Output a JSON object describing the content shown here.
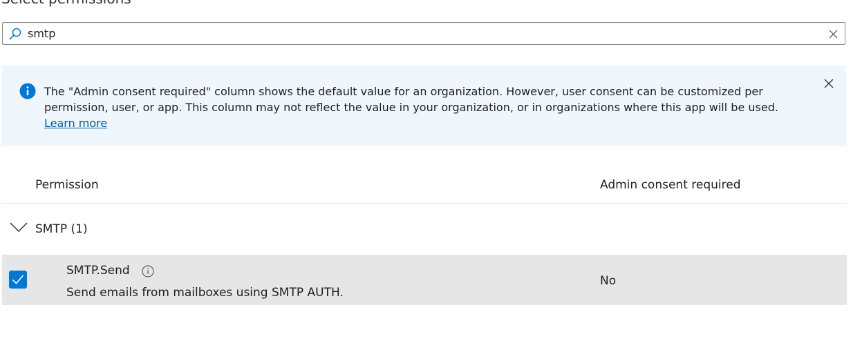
{
  "panel": {
    "title": "Select permissions"
  },
  "search": {
    "value": "smtp",
    "placeholder": ""
  },
  "banner": {
    "text": "The \"Admin consent required\" column shows the default value for an organization. However, user consent can be customized per permission, user, or app. This column may not reflect the value in your organization, or in organizations where this app will be used.",
    "link_label": "Learn more"
  },
  "table": {
    "columns": [
      "Permission",
      "Admin consent required"
    ],
    "groups": [
      {
        "label": "SMTP (1)",
        "expanded": true,
        "permissions": [
          {
            "name": "SMTP.Send",
            "description": "Send emails from mailboxes using SMTP AUTH.",
            "admin_consent": "No",
            "checked": true
          }
        ]
      }
    ]
  },
  "colors": {
    "accent": "#0078d4",
    "banner_bg": "#eff6fc",
    "selected_row_bg": "#e6e6e6",
    "link": "#005a9e"
  }
}
